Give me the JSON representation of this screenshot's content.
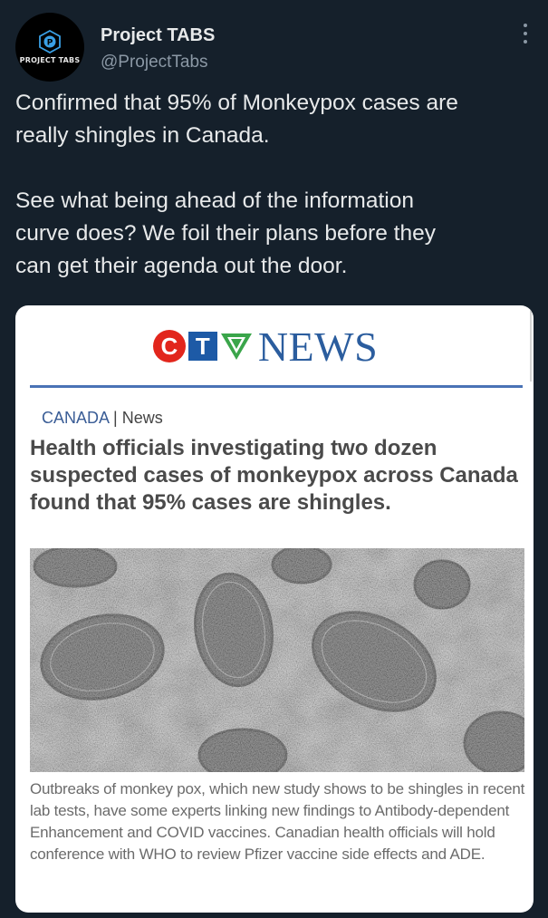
{
  "author": {
    "avatar_brand": "PROJECT TABS",
    "display_name": "Project TABS",
    "handle": "@ProjectTabs"
  },
  "tweet": {
    "text_para1": "Confirmed that 95% of Monkeypox cases are\nreally shingles in Canada.",
    "text_para2": "See what being ahead of the information\ncurve does?  We foil their plans before they\ncan get their agenda out the door."
  },
  "card": {
    "logo_c": "C",
    "logo_t": "T",
    "logo_news": "NEWS",
    "section_primary": "CANADA",
    "section_sep": "|",
    "section_secondary": "News",
    "headline": "Health officials investigating two dozen suspected cases of monkeypox across Canada found that 95% cases are shingles.",
    "caption": "Outbreaks of monkey pox, which new study shows to be shingles in recent lab tests, have some experts linking new findings to Antibody-dependent Enhancement and COVID vaccines. Canadian health officials will hold conference with WHO to review Pfizer vaccine side effects and ADE.",
    "image": "monkeypox virus micrograph"
  },
  "colors": {
    "background": "#15202b",
    "ctv_red": "#e2261c",
    "ctv_blue": "#1d5aa6",
    "ctv_green": "#3aa54a"
  }
}
